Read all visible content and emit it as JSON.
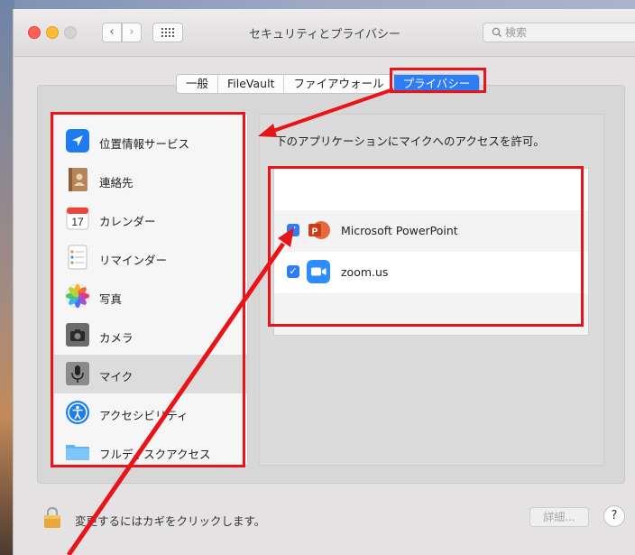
{
  "window": {
    "title": "セキュリティとプライバシー",
    "search_placeholder": "検索",
    "back_glyph": "‹",
    "forward_glyph": "›"
  },
  "tabs": [
    {
      "label": "一般",
      "active": false
    },
    {
      "label": "FileVault",
      "active": false
    },
    {
      "label": "ファイアウォール",
      "active": false
    },
    {
      "label": "プライバシー",
      "active": true
    }
  ],
  "sidebar": {
    "items": [
      {
        "label": "位置情報サービス",
        "icon": "location-arrow-icon"
      },
      {
        "label": "連絡先",
        "icon": "contacts-book-icon"
      },
      {
        "label": "カレンダー",
        "icon": "calendar-icon",
        "icon_text": "17"
      },
      {
        "label": "リマインダー",
        "icon": "reminders-icon"
      },
      {
        "label": "写真",
        "icon": "photos-icon"
      },
      {
        "label": "カメラ",
        "icon": "camera-icon"
      },
      {
        "label": "マイク",
        "icon": "microphone-icon",
        "selected": true
      },
      {
        "label": "アクセシビリティ",
        "icon": "accessibility-icon"
      },
      {
        "label": "フルディスクアクセス",
        "icon": "folder-icon"
      }
    ]
  },
  "main": {
    "caption": "下のアプリケーションにマイクへのアクセスを許可。",
    "apps": [
      {
        "name": "Microsoft PowerPoint",
        "checked": true,
        "icon": "powerpoint-icon",
        "icon_text": "P"
      },
      {
        "name": "zoom.us",
        "checked": true,
        "icon": "zoom-icon"
      }
    ]
  },
  "footer": {
    "lock_text": "変更するにはカギをクリックします。",
    "details_label": "詳細...",
    "help_label": "?"
  },
  "annotations": {
    "highlight_color": "#e8141a"
  }
}
